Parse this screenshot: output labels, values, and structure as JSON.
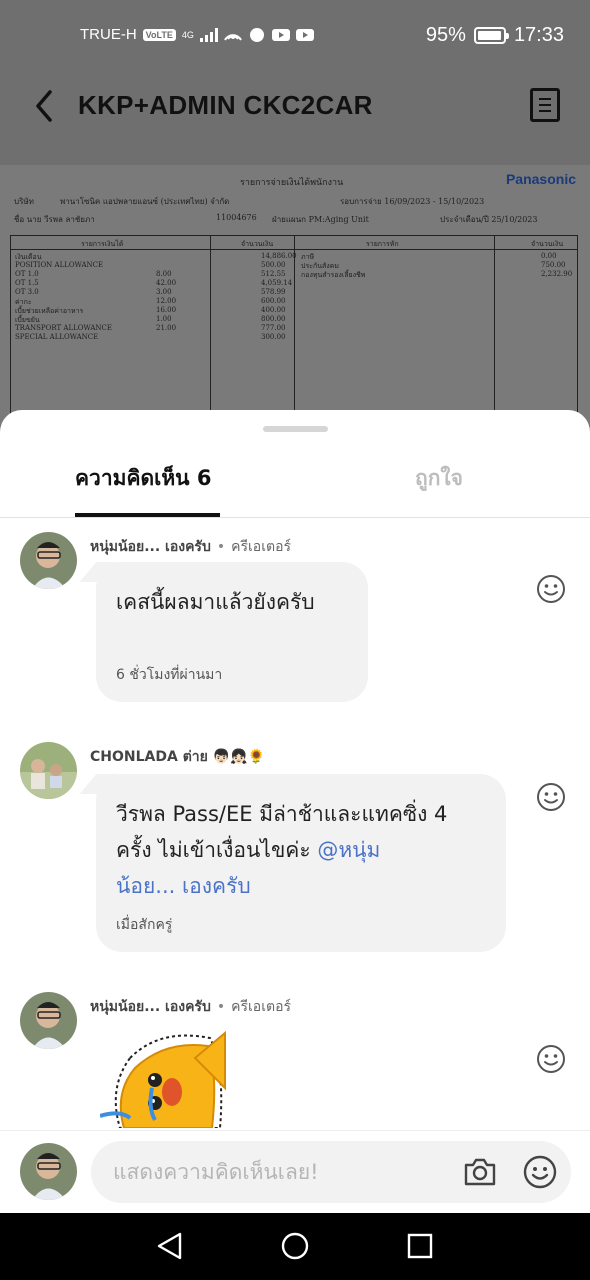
{
  "status_bar": {
    "carrier": "TRUE-H",
    "volte": "VoLTE",
    "network": "4G",
    "battery": "95%",
    "battery_level": 0.95,
    "time": "17:33"
  },
  "header": {
    "title": "KKP+ADMIN CKC2CAR",
    "back_icon": "chevron-left-icon",
    "menu_icon": "document-icon"
  },
  "payslip": {
    "title": "รายการจ่ายเงินได้พนักงาน",
    "brand": "Panasonic",
    "company_label": "บริษัท",
    "company_name": "พานาโซนิค แอปพลายแอนซ์ (ประเทศไทย) จำกัด",
    "pay_period": "รอบการจ่าย 16/09/2023 - 15/10/2023",
    "name": "ชื่อ นาย วีรพล ลาชัยภา",
    "emp_no": "11004676",
    "dept": "ฝ่ายแผนก PM:Aging Unit",
    "pay_date": "ประจำเดือน/ปี 25/10/2023",
    "income_header": "รายการเงินได้",
    "amount_header": "จำนวนเงิน",
    "deduct_header": "รายการหัก",
    "deduct_amount_header": "จำนวนเงิน",
    "income_rows": [
      {
        "label": "เงินเดือน",
        "qty": "",
        "amount": "14,886.00"
      },
      {
        "label": "POSITION ALLOWANCE",
        "qty": "",
        "amount": "500.00"
      },
      {
        "label": "OT 1.0",
        "qty": "8.00",
        "amount": "512.55"
      },
      {
        "label": "OT 1.5",
        "qty": "42.00",
        "amount": "4,059.14"
      },
      {
        "label": "OT 3.0",
        "qty": "3.00",
        "amount": "578.99"
      },
      {
        "label": "ค่ากะ",
        "qty": "12.00",
        "amount": "600.00"
      },
      {
        "label": "เบี้ยช่วยเหลือค่าอาหาร",
        "qty": "16.00",
        "amount": "400.00"
      },
      {
        "label": "เบี้ยขยัน",
        "qty": "1.00",
        "amount": "800.00"
      },
      {
        "label": "TRANSPORT ALLOWANCE",
        "qty": "21.00",
        "amount": "777.00"
      },
      {
        "label": "SPECIAL ALLOWANCE",
        "qty": "",
        "amount": "300.00"
      }
    ],
    "deduct_rows": [
      {
        "label": "ภาษี",
        "amount": "0.00"
      },
      {
        "label": "ประกันสังคม",
        "amount": "750.00"
      },
      {
        "label": "กองทุนสำรองเลี้ยงชีพ",
        "amount": "2,232.90"
      }
    ]
  },
  "tabs": [
    {
      "label": "ความคิดเห็น 6",
      "active": true
    },
    {
      "label": "ถูกใจ",
      "active": false
    }
  ],
  "comments": [
    {
      "author": "หนุ่มน้อย... เองครับ",
      "role": "ครีเอเตอร์",
      "text": "เคสนี้ผลมาแล้วยังครับ",
      "time": "6 ชั่วโมงที่ผ่านมา"
    },
    {
      "author": "CHONLADA ต่าย 👦🏻👧🏻🌻",
      "text_line1": "วีรพล Pass/EE มีล่าช้าและแทคซิ่ง 4",
      "text_line2_plain": "ครั้ง ไม่เข้าเงื่อนไขค่ะ ",
      "mention_part1": "@หนุ่ม",
      "mention_part2": "น้อย... เองครับ",
      "time": "เมื่อสักครู่"
    },
    {
      "author": "หนุ่มน้อย... เองครับ",
      "role": "ครีเอเตอร์",
      "sticker": "yellow-fish-sticker"
    }
  ],
  "composer": {
    "placeholder": "แสดงความคิดเห็นเลย!",
    "camera_icon": "camera-icon",
    "emoji_icon": "emoji-icon"
  },
  "nav": {
    "back_icon": "triangle-back-icon",
    "home_icon": "circle-home-icon",
    "recents_icon": "square-recents-icon"
  }
}
